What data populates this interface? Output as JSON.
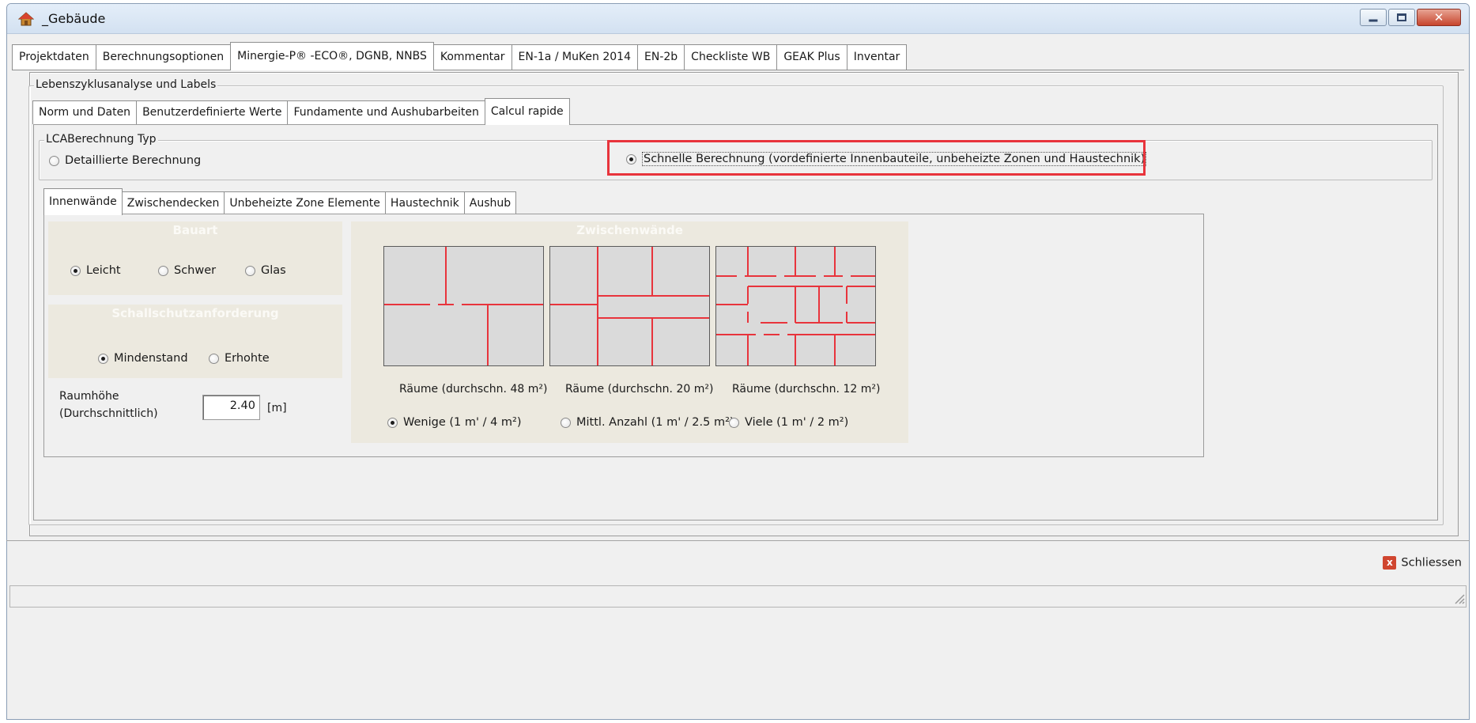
{
  "window": {
    "title": "_Gebäude",
    "close_glyph": "✕"
  },
  "top_tabs": [
    {
      "label": "Projektdaten",
      "active": false
    },
    {
      "label": "Berechnungsoptionen",
      "active": false
    },
    {
      "label": "Minergie-P® -ECO®, DGNB, NNBS",
      "active": true
    },
    {
      "label": "Kommentar",
      "active": false
    },
    {
      "label": "EN-1a / MuKen 2014",
      "active": false
    },
    {
      "label": "EN-2b",
      "active": false
    },
    {
      "label": "Checkliste WB",
      "active": false
    },
    {
      "label": "GEAK Plus",
      "active": false
    },
    {
      "label": "Inventar",
      "active": false
    }
  ],
  "group_lz": {
    "title": "Lebenszyklusanalyse und Labels"
  },
  "sub_tabs": [
    {
      "label": "Norm und Daten",
      "active": false
    },
    {
      "label": "Benutzerdefinierte Werte",
      "active": false
    },
    {
      "label": "Fundamente und Aushubarbeiten",
      "active": false
    },
    {
      "label": "Calcul rapide",
      "active": true
    }
  ],
  "lca": {
    "title": "LCABerechnung Typ",
    "option_detailed": "Detaillierte Berechnung",
    "option_quick": "Schnelle Berechnung (vordefinierte Innenbauteile, unbeheizte Zonen und Haustechnik)",
    "selected": "quick"
  },
  "inner_tabs": [
    {
      "label": "Innenwände",
      "active": true
    },
    {
      "label": "Zwischendecken",
      "active": false
    },
    {
      "label": "Unbeheizte Zone Elemente",
      "active": false
    },
    {
      "label": "Haustechnik",
      "active": false
    },
    {
      "label": "Aushub",
      "active": false
    }
  ],
  "bauart": {
    "header": "Bauart",
    "options": [
      "Leicht",
      "Schwer",
      "Glas"
    ],
    "selected": "Leicht"
  },
  "schallschutz": {
    "header": "Schallschutzanforderung",
    "options": [
      "Mindenstand",
      "Erhohte"
    ],
    "selected": "Mindenstand"
  },
  "raumhoehe": {
    "label_line1": "Raumhöhe",
    "label_line2": "(Durchschnittlich)",
    "value": "2.40",
    "unit": "[m]"
  },
  "zwischenwaende": {
    "header": "Zwischenwände",
    "captions": [
      "Räume (durchschn. 48 m²)",
      "Räume (durchschn. 20 m²)",
      "Räume (durchschn. 12 m²)"
    ],
    "options": [
      "Wenige (1 m' / 4 m²)",
      "Mittl. Anzahl  (1 m' / 2.5 m²)",
      "Viele (1 m' / 2 m²)"
    ],
    "selected": "Wenige (1 m' / 4 m²)",
    "wall_color": "#e8343c"
  },
  "footer": {
    "close_label": "Schliessen",
    "close_glyph": "x"
  },
  "colors": {
    "highlight": "#e8343c",
    "beige": "#ece9df"
  }
}
